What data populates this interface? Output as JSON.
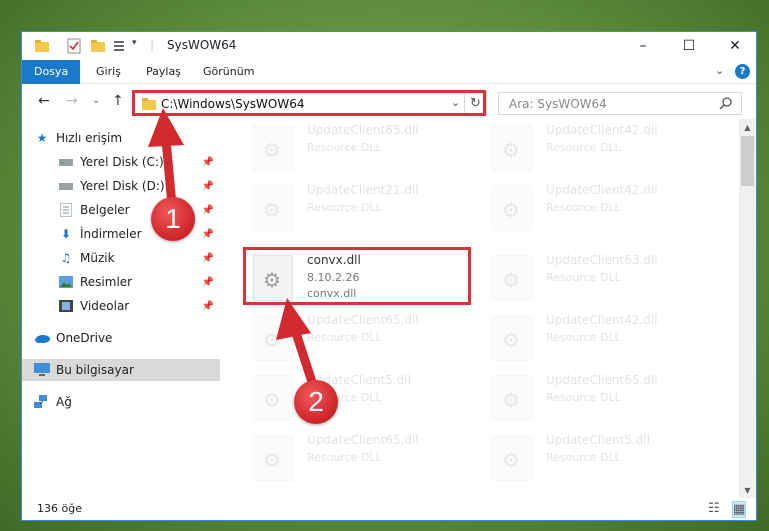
{
  "window": {
    "title": "SysWOW64",
    "controls": {
      "minimize": "–",
      "maximize": "☐",
      "close": "✕"
    }
  },
  "ribbon": {
    "tabs": [
      "Dosya",
      "Giriş",
      "Paylaş",
      "Görünüm"
    ],
    "active_tab": "Dosya",
    "collapse": "⌄",
    "help": "?"
  },
  "nav": {
    "back": "←",
    "forward": "→",
    "recent": "⌄",
    "up": "↑",
    "address": "C:\\Windows\\SysWOW64",
    "address_dropdown": "⌄",
    "refresh": "↻",
    "search_placeholder": "Ara: SysWOW64"
  },
  "sidebar": {
    "items": [
      {
        "label": "Hızlı erişim",
        "icon": "star-icon"
      },
      {
        "label": "Yerel Disk (C:)",
        "icon": "drive-icon",
        "pinned": true
      },
      {
        "label": "Yerel Disk (D:)",
        "icon": "drive-icon",
        "pinned": true
      },
      {
        "label": "Belgeler",
        "icon": "documents-icon",
        "pinned": true
      },
      {
        "label": "İndirmeler",
        "icon": "download-icon",
        "pinned": true
      },
      {
        "label": "Müzik",
        "icon": "music-icon",
        "pinned": true
      },
      {
        "label": "Resimler",
        "icon": "pictures-icon",
        "pinned": true
      },
      {
        "label": "Videolar",
        "icon": "videos-icon",
        "pinned": true
      },
      {
        "label": "OneDrive",
        "icon": "cloud-icon"
      },
      {
        "label": "Bu bilgisayar",
        "icon": "computer-icon",
        "selected": true
      },
      {
        "label": "Ağ",
        "icon": "network-icon"
      }
    ]
  },
  "files": [
    {
      "name": "UpdateClient65.dll",
      "type": "Resource DLL"
    },
    {
      "name": "UpdateClient42.dll",
      "type": "Resource DLL"
    },
    {
      "name": "UpdateClient21.dll",
      "type": "Resource DLL"
    },
    {
      "name": "UpdateClient42.dll",
      "type": "Resource DLL"
    },
    {
      "name": "convx.dll",
      "version": "8.10.2.26",
      "desc": "convx.dll",
      "highlight": true
    },
    {
      "name": "UpdateClient63.dll",
      "type": "Resource DLL"
    },
    {
      "name": "UpdateClient65.dll",
      "type": "Resource DLL"
    },
    {
      "name": "UpdateClient42.dll",
      "type": "Resource DLL"
    },
    {
      "name": "UpdateClient5.dll",
      "type": "Resource DLL"
    },
    {
      "name": "UpdateClient65.dll",
      "type": "Resource DLL"
    },
    {
      "name": "UpdateClient65.dll",
      "type": "Resource DLL"
    },
    {
      "name": "UpdateClient5.dll",
      "type": "Resource DLL"
    }
  ],
  "status": {
    "count": "136 öğe"
  },
  "annotations": {
    "step1": "1",
    "step2": "2",
    "color": "#d8333a"
  }
}
